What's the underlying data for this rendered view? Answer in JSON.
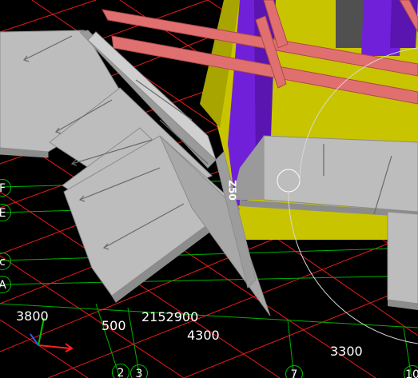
{
  "viewport": {
    "background": "#000000",
    "grid_red": "#ff2020",
    "grid_green": "#00b000"
  },
  "dimensions": {
    "d1": "3800",
    "d2": "500",
    "d3": "2152900",
    "d4": "4300",
    "d5": "3300"
  },
  "axis_labels": {
    "F": "F",
    "E": "E",
    "C": "c",
    "A": "A",
    "n2": "2",
    "n3": "3",
    "n7": "7",
    "n10": "10"
  },
  "column_tag": "Z50",
  "colors": {
    "slab_gray": "#bdbdbd",
    "slab_gray_dark": "#8c8c8c",
    "wall_yellow": "#c8c400",
    "column_purple": "#7020d8",
    "beam_salmon": "#e07070"
  },
  "icons": {
    "orientation": "xyz-triad-icon",
    "snap": "snap-circle-icon"
  }
}
